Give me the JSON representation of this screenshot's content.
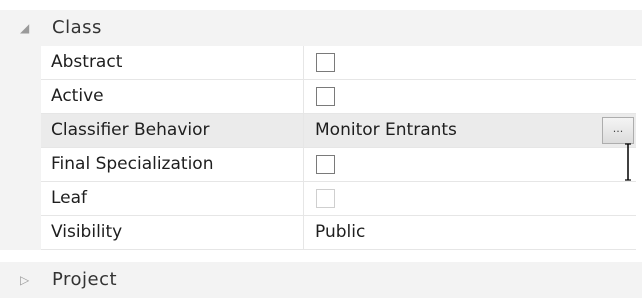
{
  "categories": {
    "class": {
      "label": "Class",
      "expanded": true,
      "arrow_icon": "triangle-expanded-icon"
    },
    "project": {
      "label": "Project",
      "expanded": false,
      "arrow_icon": "triangle-collapsed-icon"
    }
  },
  "properties": [
    {
      "name": "Abstract",
      "type": "checkbox",
      "checked": false,
      "enabled": true
    },
    {
      "name": "Active",
      "type": "checkbox",
      "checked": false,
      "enabled": true
    },
    {
      "name": "Classifier Behavior",
      "type": "text-with-button",
      "value": "Monitor Entrants",
      "button_label": "...",
      "selected": true
    },
    {
      "name": "Final Specialization",
      "type": "checkbox",
      "checked": false,
      "enabled": true
    },
    {
      "name": "Leaf",
      "type": "checkbox",
      "checked": false,
      "enabled": false
    },
    {
      "name": "Visibility",
      "type": "text",
      "value": "Public"
    }
  ],
  "colors": {
    "category_bg": "#f3f3f3",
    "selected_row_bg": "#ebebeb",
    "grid_line": "#e6e6e6"
  }
}
